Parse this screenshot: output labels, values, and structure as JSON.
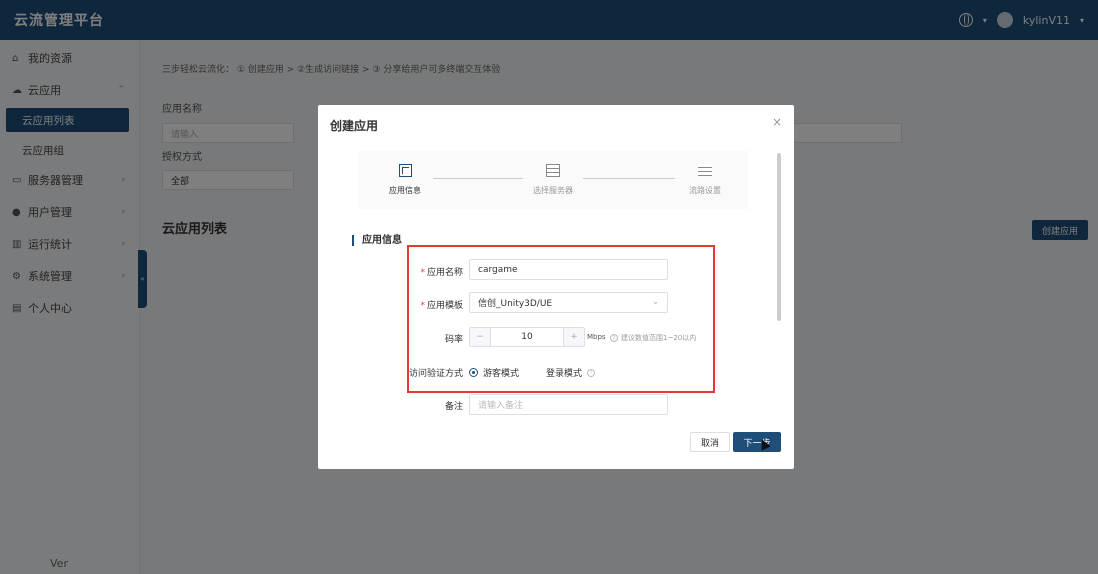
{
  "header": {
    "brand": "云流管理平台",
    "username": "kylinV11"
  },
  "sidebar": {
    "items": [
      {
        "label": "我的资源"
      },
      {
        "label": "云应用"
      },
      {
        "label": "云应用列表"
      },
      {
        "label": "云应用组"
      },
      {
        "label": "服务器管理"
      },
      {
        "label": "用户管理"
      },
      {
        "label": "运行统计"
      },
      {
        "label": "系统管理"
      },
      {
        "label": "个人中心"
      }
    ],
    "version": "Ver"
  },
  "main": {
    "tip": "三步轻松云流化： ① 创建应用 > ②生成访问链接 > ③ 分享给用户可多终端交互体验",
    "filters": {
      "app_name_label": "应用名称",
      "app_name_placeholder": "请输入",
      "auth_label": "授权方式",
      "auth_value": "全部"
    },
    "list_title": "云应用列表",
    "create_button": "创建应用"
  },
  "modal": {
    "title": "创建应用",
    "steps": [
      "应用信息",
      "选择服务器",
      "流路设置"
    ],
    "section_title": "应用信息",
    "fields": {
      "name_label": "应用名称",
      "name_value": "cargame",
      "template_label": "应用模板",
      "template_value": "信创_Unity3D/UE",
      "bitrate_label": "码率",
      "bitrate_value": "10",
      "bitrate_unit": "Mbps",
      "bitrate_hint": "建议数值范围1~20以内",
      "auth_label": "访问验证方式",
      "auth_options": [
        "游客模式",
        "登录模式"
      ],
      "remark_label": "备注",
      "remark_placeholder": "请输入备注"
    },
    "cancel_button": "取消",
    "next_button": "下一步"
  },
  "colors": {
    "primary": "#1f4e79",
    "highlight": "#e53935"
  }
}
